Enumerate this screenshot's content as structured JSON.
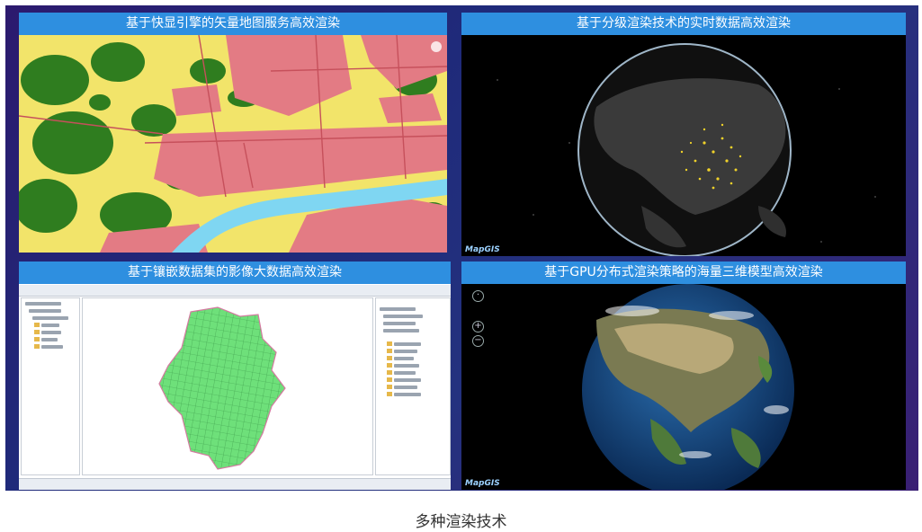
{
  "panels": {
    "vector": {
      "title": "基于快显引擎的矢量地图服务高效渲染"
    },
    "realtime": {
      "title": "基于分级渲染技术的实时数据高效渲染",
      "logo": "MapGIS"
    },
    "imagery": {
      "title": "基于镶嵌数据集的影像大数据高效渲染"
    },
    "model3d": {
      "title": "基于GPU分布式渲染策略的海量三维模型高效渲染",
      "logo": "MapGIS"
    }
  },
  "caption": "多种渲染技术",
  "colors": {
    "title_bar": "#2e8fe0",
    "frame": "#24327f",
    "urban": "#e37b84",
    "forest": "#2f7d1f",
    "farmland": "#f2e46a",
    "river": "#7fd6f2"
  },
  "icons": [
    "zoom-in-icon",
    "zoom-out-icon",
    "compass-icon",
    "folder-icon"
  ]
}
